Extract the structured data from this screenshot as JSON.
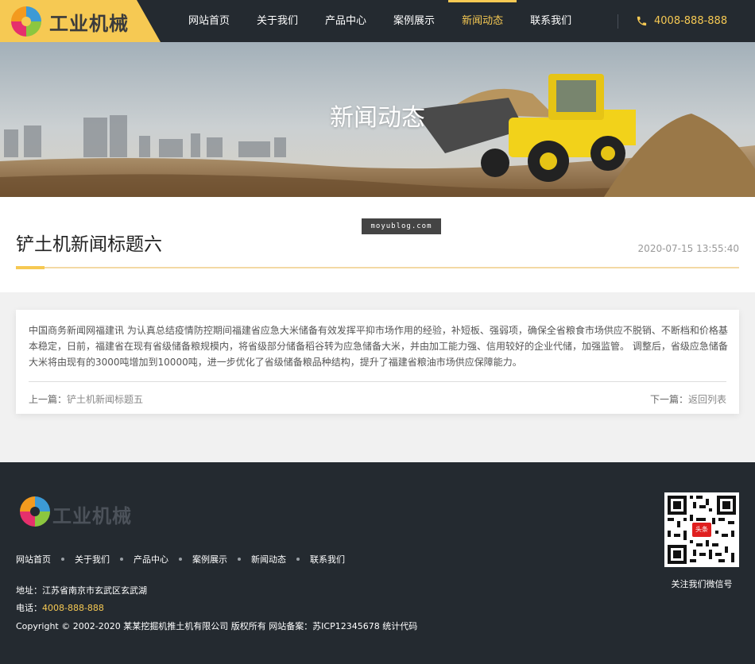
{
  "header": {
    "logo_text": "工业机械",
    "nav": [
      {
        "label": "网站首页"
      },
      {
        "label": "关于我们"
      },
      {
        "label": "产品中心"
      },
      {
        "label": "案例展示"
      },
      {
        "label": "新闻动态",
        "active": true
      },
      {
        "label": "联系我们"
      }
    ],
    "phone": "4008-888-888",
    "icons": {
      "phone": "phone-icon",
      "logo": "four-color-circle-logo"
    }
  },
  "banner": {
    "title": "新闻动态"
  },
  "watermark": "moyublog.com",
  "article": {
    "title": "铲土机新闻标题六",
    "date": "2020-07-15 13:55:40",
    "body": "中国商务新闻网福建讯 为认真总结疫情防控期间福建省应急大米储备有效发挥平抑市场作用的经验，补短板、强弱项，确保全省粮食市场供应不脱销、不断档和价格基本稳定，日前，福建省在现有省级储备粮规模内，将省级部分储备稻谷转为应急储备大米，并由加工能力强、信用较好的企业代储，加强监管。 调整后，省级应急储备大米将由现有的3000吨增加到10000吨，进一步优化了省级储备粮品种结构，提升了福建省粮油市场供应保障能力。",
    "prev_label": "上一篇：",
    "prev_value": "铲土机新闻标题五",
    "next_label": "下一篇：",
    "next_value": "返回列表"
  },
  "footer": {
    "logo_text": "工业机械",
    "nav": [
      "网站首页",
      "关于我们",
      "产品中心",
      "案例展示",
      "新闻动态",
      "联系我们"
    ],
    "address": "地址：江苏省南京市玄武区玄武湖",
    "tel_label": "电话：",
    "tel_value": "4008-888-888",
    "copyright": "Copyright © 2002-2020 某某挖掘机推土机有限公司 版权所有 网站备案：苏ICP12345678 统计代码",
    "qr_label": "关注我们微信号",
    "qr_badge": "头条"
  },
  "colors": {
    "accent": "#f6c953",
    "dark": "#242a30"
  }
}
